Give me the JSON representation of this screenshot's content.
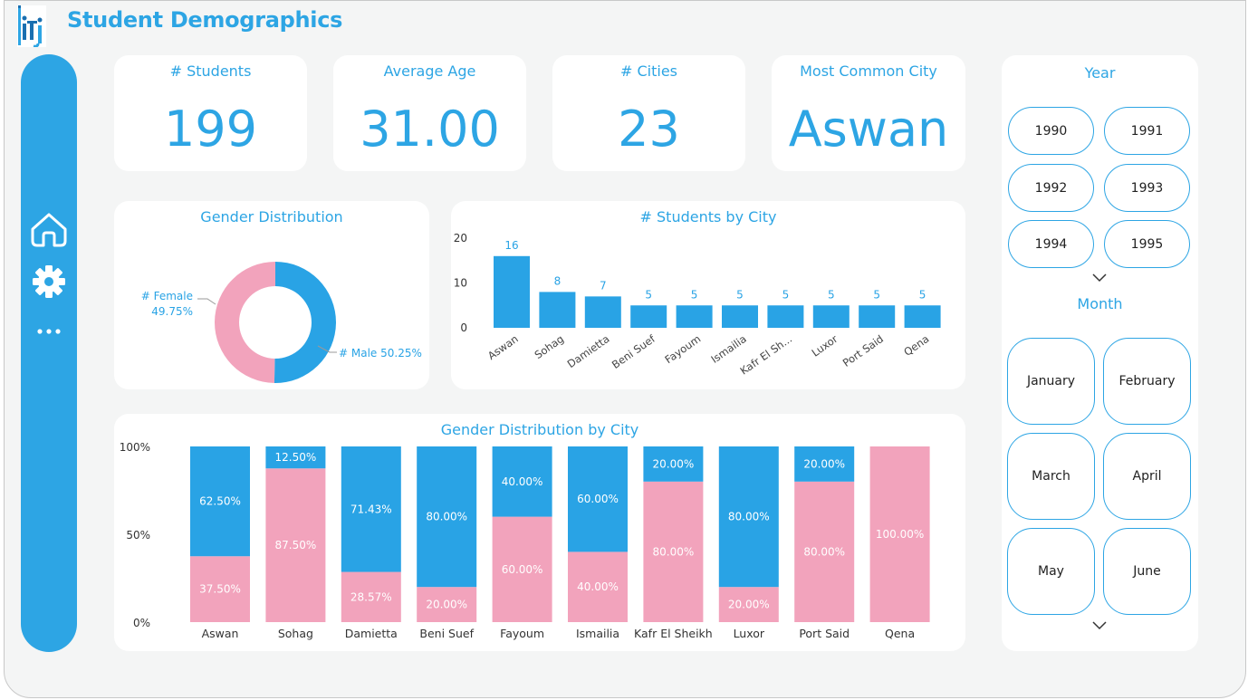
{
  "header": {
    "title": "Student Demographics",
    "logo_icon": "iti-logo"
  },
  "sidebar": {
    "items": [
      {
        "icon": "home-icon"
      },
      {
        "icon": "gear-icon"
      },
      {
        "icon": "more-icon"
      }
    ]
  },
  "kpis": [
    {
      "label": "# Students",
      "value": "199"
    },
    {
      "label": "Average Age",
      "value": "31.00"
    },
    {
      "label": "# Cities",
      "value": "23"
    },
    {
      "label": "Most Common City",
      "value": "Aswan"
    }
  ],
  "colors": {
    "accent": "#2da5e4",
    "female": "#f2a3bc",
    "male": "#29a3e5",
    "background": "#f4f5f5"
  },
  "chart_data": [
    {
      "type": "pie",
      "title": "Gender Distribution",
      "slices": [
        {
          "label": "# Female",
          "pct_label": "49.75%",
          "value": 49.75
        },
        {
          "label": "# Male",
          "pct_label": "50.25%",
          "value": 50.25
        }
      ]
    },
    {
      "type": "bar",
      "title": "# Students by City",
      "categories": [
        "Aswan",
        "Sohag",
        "Damietta",
        "Beni Suef",
        "Fayoum",
        "Ismailia",
        "Kafr El Sh...",
        "Luxor",
        "Port Said",
        "Qena"
      ],
      "values": [
        16,
        8,
        7,
        5,
        5,
        5,
        5,
        5,
        5,
        5
      ],
      "yticks": [
        "0",
        "10",
        "20"
      ],
      "ylim": [
        0,
        20
      ]
    },
    {
      "type": "bar",
      "stacked": "100%",
      "title": "Gender Distribution by City",
      "categories": [
        "Aswan",
        "Sohag",
        "Damietta",
        "Beni Suef",
        "Fayoum",
        "Ismailia",
        "Kafr El Sheikh",
        "Luxor",
        "Port Said",
        "Qena"
      ],
      "series": [
        {
          "values": [
            37.5,
            87.5,
            28.57,
            20,
            60,
            40,
            80,
            20,
            80,
            100
          ],
          "labels": [
            "37.50%",
            "87.50%",
            "28.57%",
            "20.00%",
            "60.00%",
            "40.00%",
            "80.00%",
            "20.00%",
            "80.00%",
            "100.00%"
          ]
        },
        {
          "values": [
            62.5,
            12.5,
            71.43,
            80,
            40,
            60,
            20,
            80,
            20,
            0
          ],
          "labels": [
            "62.50%",
            "12.50%",
            "71.43%",
            "80.00%",
            "40.00%",
            "60.00%",
            "20.00%",
            "80.00%",
            "20.00%",
            ""
          ]
        }
      ],
      "yticks": [
        "0%",
        "50%",
        "100%"
      ],
      "ylim": [
        0,
        100
      ]
    }
  ],
  "year_slicer": {
    "title": "Year",
    "items": [
      "1990",
      "1991",
      "1992",
      "1993",
      "1994",
      "1995"
    ]
  },
  "month_slicer": {
    "title": "Month",
    "items": [
      "January",
      "February",
      "March",
      "April",
      "May",
      "June"
    ]
  }
}
